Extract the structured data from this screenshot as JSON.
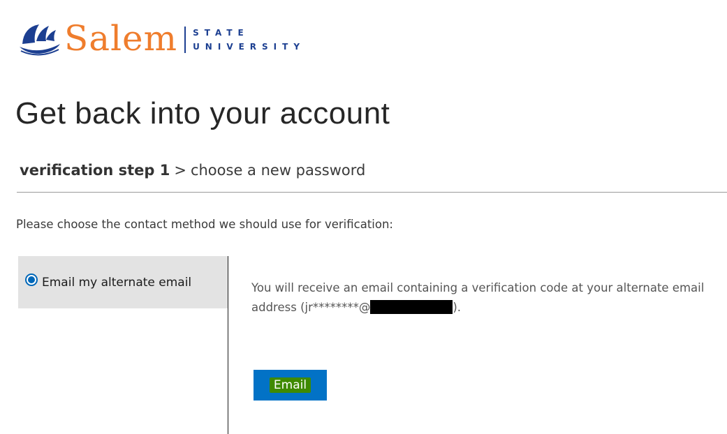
{
  "header": {
    "logo_wordmark": "Salem",
    "logo_line1": "STATE",
    "logo_line2": "UNIVERSITY",
    "logo_icon": "ship-icon"
  },
  "title": "Get back into your account",
  "breadcrumb": {
    "current": "verification step 1",
    "separator": ">",
    "next": "choose a new password"
  },
  "instruction": "Please choose the contact method we should use for verification:",
  "methods": [
    {
      "label": "Email my alternate email",
      "selected": true
    }
  ],
  "detail": {
    "text_before": "You will receive an email containing a verification code at your alternate email address (jr********@",
    "text_after": ")."
  },
  "actions": {
    "email_button": "Email"
  },
  "colors": {
    "brand_orange": "#ef7d2d",
    "brand_blue": "#1c3f91",
    "button_blue": "#0272c6",
    "highlight_green": "#3f8a00"
  }
}
